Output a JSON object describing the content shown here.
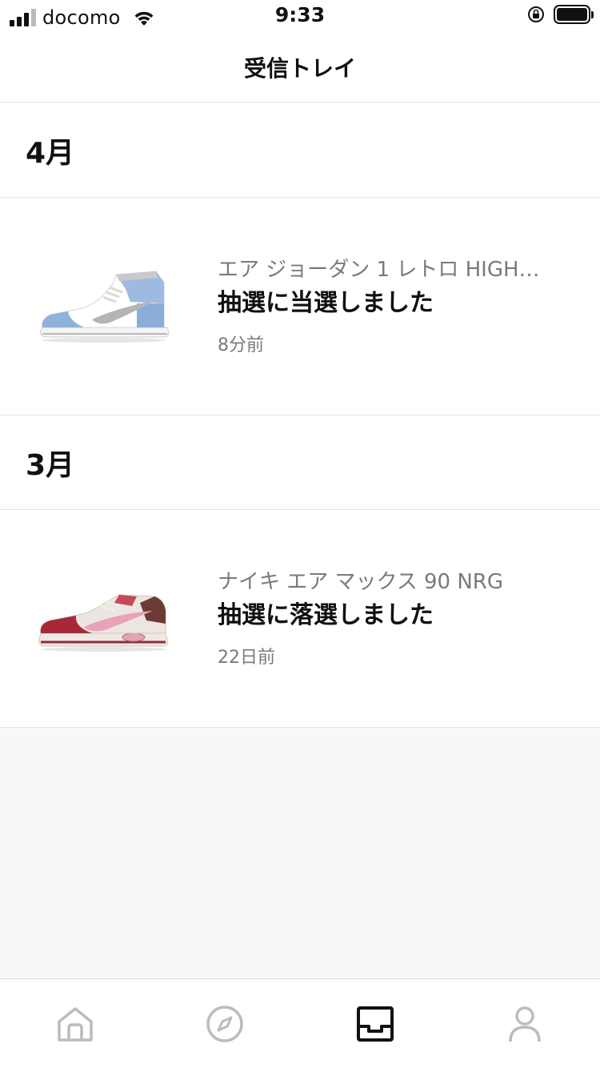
{
  "status_bar": {
    "carrier": "docomo",
    "time": "9:33"
  },
  "header": {
    "title": "受信トレイ"
  },
  "sections": [
    {
      "month": "4月",
      "items": [
        {
          "product": "エア ジョーダン 1 レトロ HIGH…",
          "message": "抽選に当選しました",
          "time": "8分前"
        }
      ]
    },
    {
      "month": "3月",
      "items": [
        {
          "product": "ナイキ エア マックス 90 NRG",
          "message": "抽選に落選しました",
          "time": "22日前"
        }
      ]
    }
  ],
  "tab_bar": {
    "tabs": [
      {
        "icon": "home-icon",
        "active": false
      },
      {
        "icon": "compass-icon",
        "active": false
      },
      {
        "icon": "inbox-icon",
        "active": true
      },
      {
        "icon": "profile-icon",
        "active": false
      }
    ]
  },
  "colors": {
    "active_tab": "#111111",
    "inactive_tab": "#bcbcbc",
    "secondary_text": "#7a7a7a"
  }
}
